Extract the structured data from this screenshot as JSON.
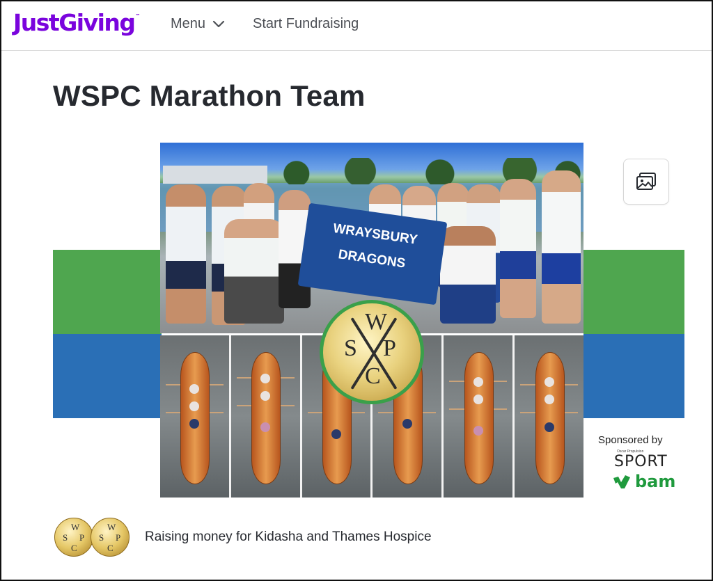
{
  "header": {
    "logo": "JustGiving",
    "logo_tm": "™",
    "menu_label": "Menu",
    "start_fundraising_label": "Start Fundraising"
  },
  "page": {
    "title": "WSPC Marathon Team"
  },
  "banner": {
    "flag_line1": "WRAYSBURY",
    "flag_line2": "DRAGONS",
    "crest_letters": [
      "W",
      "S",
      "P",
      "C"
    ],
    "colors": {
      "green": "#4fa64f",
      "blue": "#2a6fb6"
    }
  },
  "gallery_button": {
    "icon": "image-gallery-icon"
  },
  "sponsor": {
    "label": "Sponsored by",
    "small_text": "Oscar Propulsion",
    "brand_sport": "SPORT",
    "brand_bam": "bam"
  },
  "charity": {
    "text": "Raising money for Kidasha and Thames Hospice",
    "coin_letters": [
      "W",
      "S",
      "P",
      "C"
    ]
  },
  "colors": {
    "brand_purple": "#7a04dd",
    "nav_text": "#4c4f55",
    "title_text": "#26292f",
    "sponsor_green": "#1f9a3d"
  }
}
